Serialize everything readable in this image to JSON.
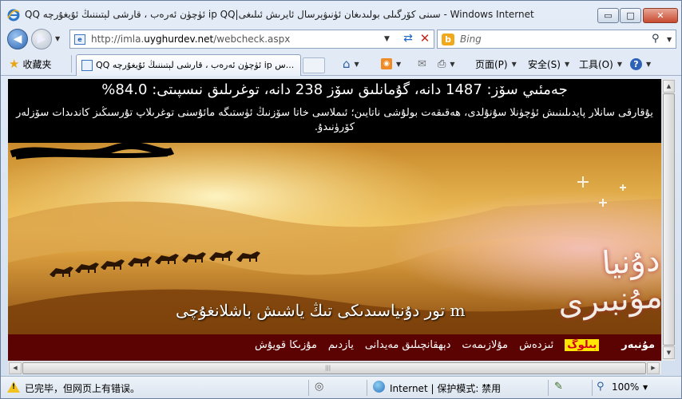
{
  "window": {
    "title": "QQ ئۈچۈن ئەرەب ، قارشى لېتىننىڭ ئۇيغۇرچە ip QQ|سىنى كۆرگىلى بولىدىغان ئۈنىۋېرسال ئايرىش ئىلىغى - Windows Internet Explorer",
    "min_label": "▭",
    "max_label": "□",
    "close_label": "✕"
  },
  "address": {
    "url_prefix": "http://imla.",
    "url_domain": "uyghurdev.net",
    "url_path": "/webcheck.aspx"
  },
  "search": {
    "placeholder": "Bing"
  },
  "toolbar": {
    "favorites_label": "收藏夹",
    "tab_label": "QQ ئۈچۈن ئەرەب ، قارشى لېتىننىڭ ئۇيغۇرچە ip س...",
    "page_label": "页面(P)",
    "safety_label": "安全(S)",
    "tools_label": "工具(O)"
  },
  "page": {
    "stats_line": "جەمئىي سۆز: 1487 دانە، گۇمانلىق سۆز 238 دانە، توغرىلىق نىسپىتى: 84.0%",
    "notice_line": "يۇقارقى سانلار پايدىلىنىش ئۈچۈنلا سۇنۇلدى، ھەقىقەت بولۇشى ناتايىن؛ ئىملاسى خاتا سۆزنىڭ ئۈستىگە مائۇسنى توغرىلاپ تۇرسىڭىز كاندىدات سۆزلەر كۆرۈنىدۇ.",
    "banner_calligraphy_right": "دۇنيا مۇنبىرى",
    "banner_calligraphy_bottom": "تور دۇنياسىدىكى تىڭ ياشىش باشلانغۇچى",
    "banner_url_fragment": "m",
    "menu": {
      "items": [
        "مۇنبەر",
        "بىلوگ",
        "ئىزدەش",
        "مۇلازىمەت",
        "دېھقانچىلىق مەيدانى",
        "يازدىم",
        "مۇزىكا قويۇش"
      ]
    }
  },
  "status": {
    "text": "已完毕，但网页上有错误。",
    "zone": "Internet | 保护模式: 禁用",
    "zoom": "100%"
  }
}
